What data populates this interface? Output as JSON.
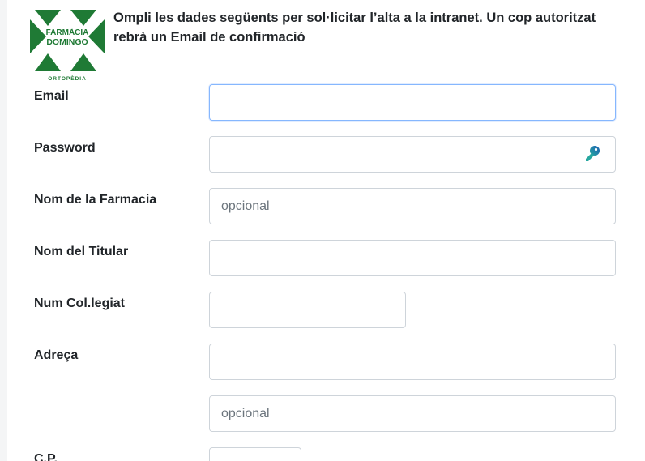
{
  "logo": {
    "line1": "FARMÀCIA",
    "line2": "DOMINGO",
    "line3": "ORTOPÈDIA"
  },
  "intro_text": "Ompli les dades següents per sol·licitar l’alta a la intranet. Un cop autoritzat rebrà un Email de confirmació",
  "form": {
    "email": {
      "label": "Email",
      "value": "",
      "placeholder": ""
    },
    "password": {
      "label": "Password",
      "value": "",
      "placeholder": ""
    },
    "pharmacy": {
      "label": "Nom de la Farmacia",
      "value": "",
      "placeholder": "opcional"
    },
    "holder": {
      "label": "Nom del Titular",
      "value": "",
      "placeholder": ""
    },
    "membership": {
      "label": "Num Col.legiat",
      "value": "",
      "placeholder": ""
    },
    "address": {
      "label": "Adreça",
      "value": "",
      "placeholder": ""
    },
    "address2": {
      "value": "",
      "placeholder": "opcional"
    },
    "postal_code": {
      "label": "C.P."
    }
  },
  "colors": {
    "logo_green": "#1f7a35",
    "key_icon": [
      "#27a7a0",
      "#1c5fb3"
    ],
    "focus_border": "#86b7fe"
  }
}
